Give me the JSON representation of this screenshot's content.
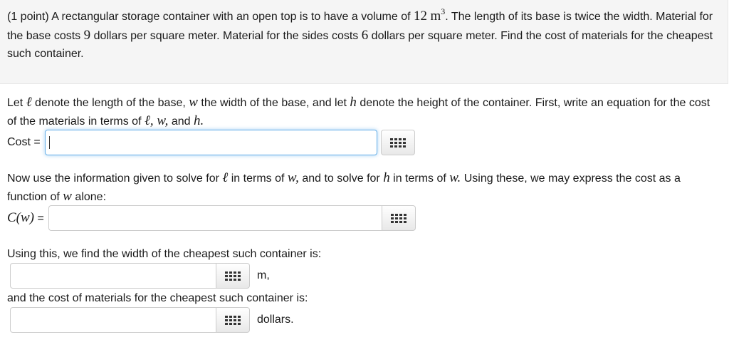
{
  "problem": {
    "part1": "(1 point) A rectangular storage container with an open top is to have a volume of ",
    "volume_value": "12",
    "volume_unit": "m",
    "volume_exp": "3",
    "part2": ". The length of its base is twice the width. Material for the base costs ",
    "base_cost": "9",
    "part3": " dollars per square meter. Material for the sides costs ",
    "side_cost": "6",
    "part4": " dollars per square meter. Find the cost of materials for the cheapest such container."
  },
  "instruction1": {
    "a": "Let ",
    "ell": "ℓ",
    "b": " denote the length of the base, ",
    "w": "w",
    "c": " the width of the base, and let ",
    "h": "h",
    "d": " denote the height of the container. First, write an equation for the cost of the materials in terms of ",
    "list": "ℓ, w,",
    "e": " and ",
    "h2": "h.",
    "cost_label": "Cost ="
  },
  "instruction2": {
    "a": "Now use the information given to solve for ",
    "ell": "ℓ",
    "b": " in terms of ",
    "w": "w,",
    "c": " and to solve for ",
    "h": "h",
    "d": " in terms of ",
    "w2": "w.",
    "e": " Using these, we may express the cost as a function of ",
    "w3": "w",
    "f": " alone:",
    "cw_label": "C(w)",
    "eq": " ="
  },
  "instruction3": {
    "text": "Using this, we find the width of the cheapest such container is:",
    "unit": "m,"
  },
  "instruction4": {
    "text": "and the cost of materials for the cheapest such container is:",
    "unit": "dollars."
  }
}
